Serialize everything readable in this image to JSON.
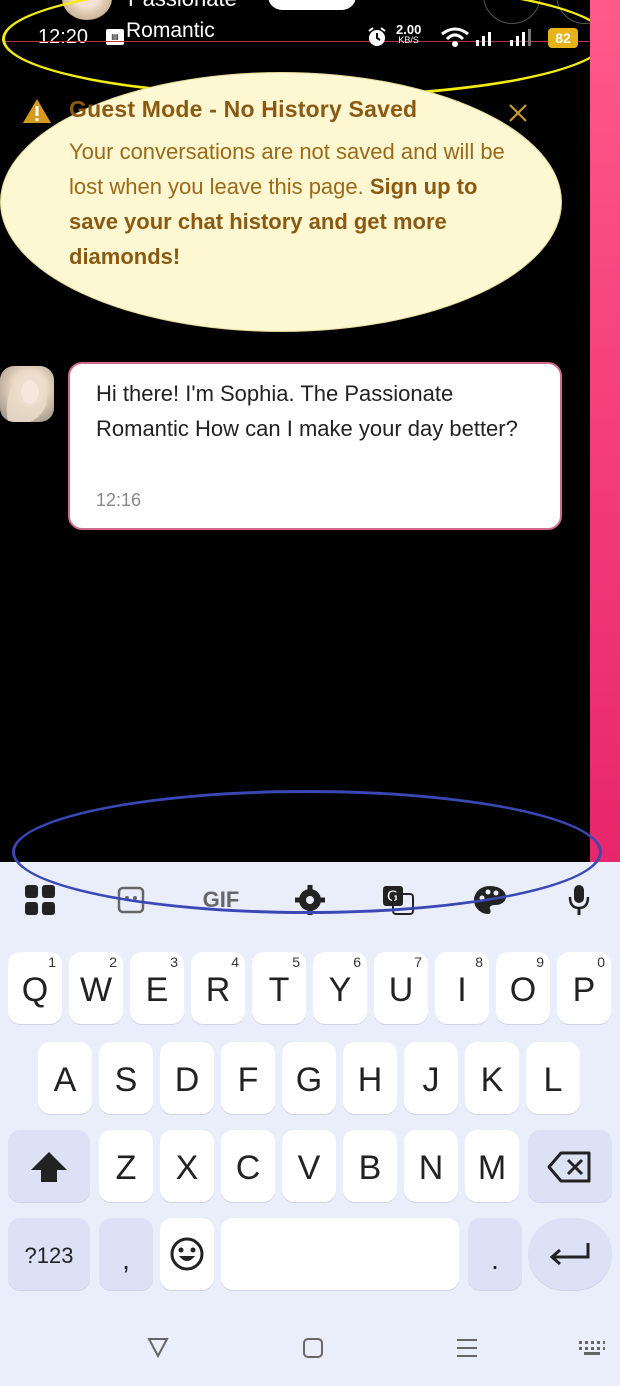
{
  "header": {
    "title_partial": "Passionate",
    "romantic": "Romantic"
  },
  "status_bar": {
    "time": "12:20",
    "net_speed_value": "2.00",
    "net_speed_unit": "KB/S",
    "battery": "82"
  },
  "guest_banner": {
    "title": "Guest Mode - No History Saved",
    "body": "Your conversations are not saved and will be lost when you leave this page.",
    "cta": "Sign up to save your chat history and get more diamonds!"
  },
  "message": {
    "text": "Hi there! I'm Sophia. The Passionate Romantic How can I make your day better?",
    "time": "12:16"
  },
  "keyboard": {
    "gif_label": "GIF",
    "row1": [
      {
        "letter": "Q",
        "hint": "1"
      },
      {
        "letter": "W",
        "hint": "2"
      },
      {
        "letter": "E",
        "hint": "3"
      },
      {
        "letter": "R",
        "hint": "4"
      },
      {
        "letter": "T",
        "hint": "5"
      },
      {
        "letter": "Y",
        "hint": "6"
      },
      {
        "letter": "U",
        "hint": "7"
      },
      {
        "letter": "I",
        "hint": "8"
      },
      {
        "letter": "O",
        "hint": "9"
      },
      {
        "letter": "P",
        "hint": "0"
      }
    ],
    "row2": [
      "A",
      "S",
      "D",
      "F",
      "G",
      "H",
      "J",
      "K",
      "L"
    ],
    "row3": [
      "Z",
      "X",
      "C",
      "V",
      "B",
      "N",
      "M"
    ],
    "symbols_label": "?123",
    "comma_label": ",",
    "period_label": "."
  },
  "colors": {
    "status_line": "#b2343e",
    "guest_banner_bg": "#fdf7d2",
    "guest_title": "#8a5a12",
    "bubble_border": "#d06a8a",
    "side_gradient": "#f43e7b",
    "keyboard_bg": "#eaeefb",
    "yellow_annotation": "#f3ec11",
    "blue_annotation": "#3a48b6"
  }
}
